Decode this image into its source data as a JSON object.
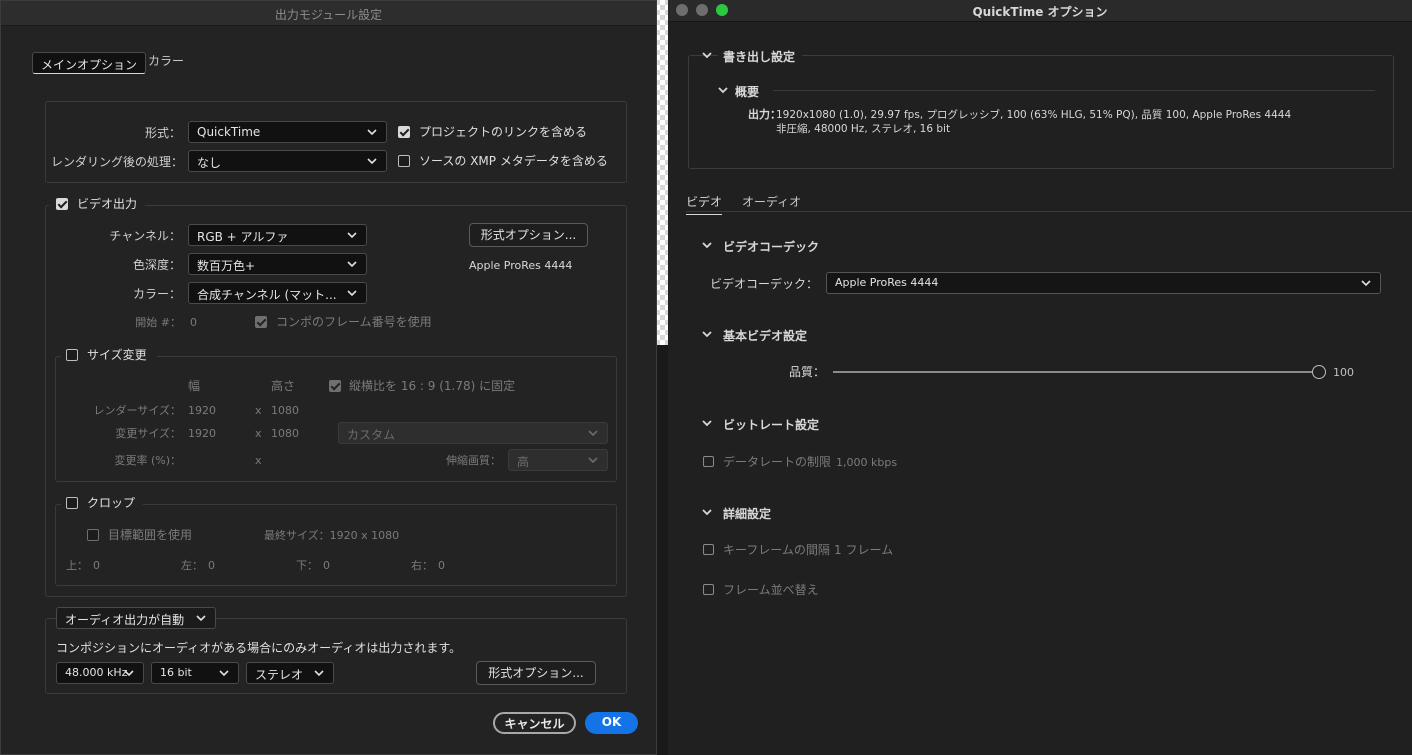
{
  "left": {
    "title": "出力モジュール設定",
    "tabs": [
      "メインオプション",
      "カラー"
    ],
    "format_label": "形式：",
    "format_value": "QuickTime",
    "post_render_label": "レンダリング後の処理：",
    "post_render_value": "なし",
    "include_project_link": "プロジェクトのリンクを含める",
    "include_xmp": "ソースの XMP メタデータを含める",
    "video_output": "ビデオ出力",
    "channels_label": "チャンネル：",
    "channels_value": "RGB + アルファ",
    "depth_label": "色深度：",
    "depth_value": "数百万色+",
    "color_label": "カラー：",
    "color_value": "合成チャンネル (マット...",
    "format_options": "形式オプション...",
    "codec_summary": "Apple ProRes 4444",
    "start_label": "開始 #：",
    "start_value": "0",
    "use_comp_frame": "コンポのフレーム番号を使用",
    "resize": "サイズ変更",
    "width_h": "幅",
    "height_h": "高さ",
    "lock_aspect": "縦横比を 16 : 9 (1.78) に固定",
    "render_size_label": "レンダーサイズ：",
    "render_w": "1920",
    "render_x": "x",
    "render_h": "1080",
    "resize_to_label": "変更サイズ：",
    "resize_w": "1920",
    "resize_x": "x",
    "resize_h": "1080",
    "resize_preset": "カスタム",
    "resize_pct_label": "変更率 (%)：",
    "resize_pct_x": "x",
    "stretch_quality_label": "伸縮画質：",
    "stretch_quality_value": "高",
    "crop": "クロップ",
    "use_roi": "目標範囲を使用",
    "final_size": "最終サイズ：1920 x 1080",
    "top_label": "上：",
    "top_value": "0",
    "left_label": "左：",
    "left_value": "0",
    "bottom_label": "下：",
    "bottom_value": "0",
    "right_label": "右：",
    "right_value": "0",
    "audio_auto": "オーディオ出力が自動",
    "audio_note": "コンポジションにオーディオがある場合にのみオーディオは出力されます。",
    "sample_rate": "48.000 kHz",
    "bit_depth": "16 bit",
    "channels_audio": "ステレオ",
    "audio_format_options": "形式オプション...",
    "cancel": "キャンセル",
    "ok": "OK"
  },
  "right": {
    "title": "QuickTime オプション",
    "export_settings": "書き出し設定",
    "summary": "概要",
    "output_label": "出力：",
    "output_line1": "1920x1080 (1.0), 29.97 fps, プログレッシブ, 100 (63% HLG, 51% PQ), 品質 100, Apple ProRes 4444",
    "output_line2": "非圧縮, 48000 Hz, ステレオ, 16 bit",
    "tabs": [
      "ビデオ",
      "オーディオ"
    ],
    "video_codec_section": "ビデオコーデック",
    "video_codec_label": "ビデオコーデック：",
    "video_codec_value": "Apple ProRes 4444",
    "basic_video": "基本ビデオ設定",
    "quality_label": "品質：",
    "quality_value": "100",
    "quality_level": 1.0,
    "bitrate_section": "ビットレート設定",
    "limit_data_rate": "データレートの制限",
    "data_rate_value": "1,000 kbps",
    "advanced": "詳細設定",
    "keyframe_every": "キーフレームの間隔",
    "keyframe_value": "1 フレーム",
    "frame_reorder": "フレーム並べ替え"
  },
  "colors": {
    "accent": "#1473e6",
    "traffic": [
      "#6e6e6e",
      "#6e6e6e",
      "#2ac940"
    ]
  }
}
